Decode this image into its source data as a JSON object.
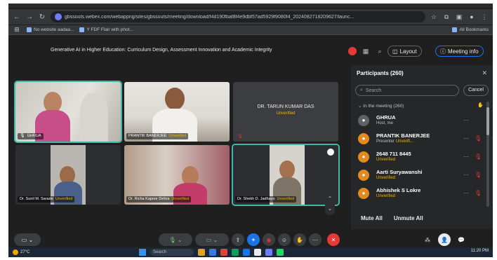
{
  "browser": {
    "url": "gbssouts.webex.com/webappng/sites/gbssouts/meeting/download/f4d190fbaf8f4e9dbf57ad5929f9080f4_2024082718209627/launc...",
    "bookmarks": [
      "No website aadaa...",
      "Y FDF Flair with phot..."
    ],
    "all_bookmarks": "All Bookmarks"
  },
  "meeting": {
    "title": "Generative AI in Higher Education: Curriculum Design, Assessment Innovation and Academic Integrity",
    "layout_label": "Layout",
    "meeting_info_label": "Meeting info"
  },
  "tiles": [
    {
      "name": "GHRUA",
      "status": ""
    },
    {
      "name": "PRANTIK BANERJEE",
      "status": "Unverified"
    },
    {
      "name": "DR. TARUN KUMAR DAS",
      "status": "Unverified"
    },
    {
      "name": "Dr. Sunil M. Sarade",
      "status": "Unverified"
    },
    {
      "name": "Dr. Richa Kapoor Dehra",
      "status": "Unverified"
    },
    {
      "name": "Dr. Shekh D. Jadhavo",
      "status": "Unverified"
    }
  ],
  "participants": {
    "title": "Participants (260)",
    "search_placeholder": "Search",
    "cancel_label": "Cancel",
    "section_label": "In the meeting (260)",
    "list": [
      {
        "name": "GHRUA",
        "sub": "Host, me",
        "status": ""
      },
      {
        "name": "PRANTIK BANERJEE",
        "sub": "Presenter",
        "status": "Unverifi..."
      },
      {
        "name": "2648 711 8445",
        "sub": "",
        "status": "Unverified"
      },
      {
        "name": "Aarti Suryawanshi",
        "sub": "",
        "status": "Unverified"
      },
      {
        "name": "Abhishek S Lokre",
        "sub": "",
        "status": "Unverified"
      }
    ],
    "mute_all": "Mute All",
    "unmute_all": "Unmute All"
  },
  "taskbar": {
    "temperature": "27°C",
    "search_placeholder": "Search",
    "time": "11:20 PM"
  },
  "colors": {
    "active_border": "#3fb9a7",
    "unverified": "#f4b400",
    "end_call": "#e53935",
    "meeting_info": "#1a73e8"
  }
}
